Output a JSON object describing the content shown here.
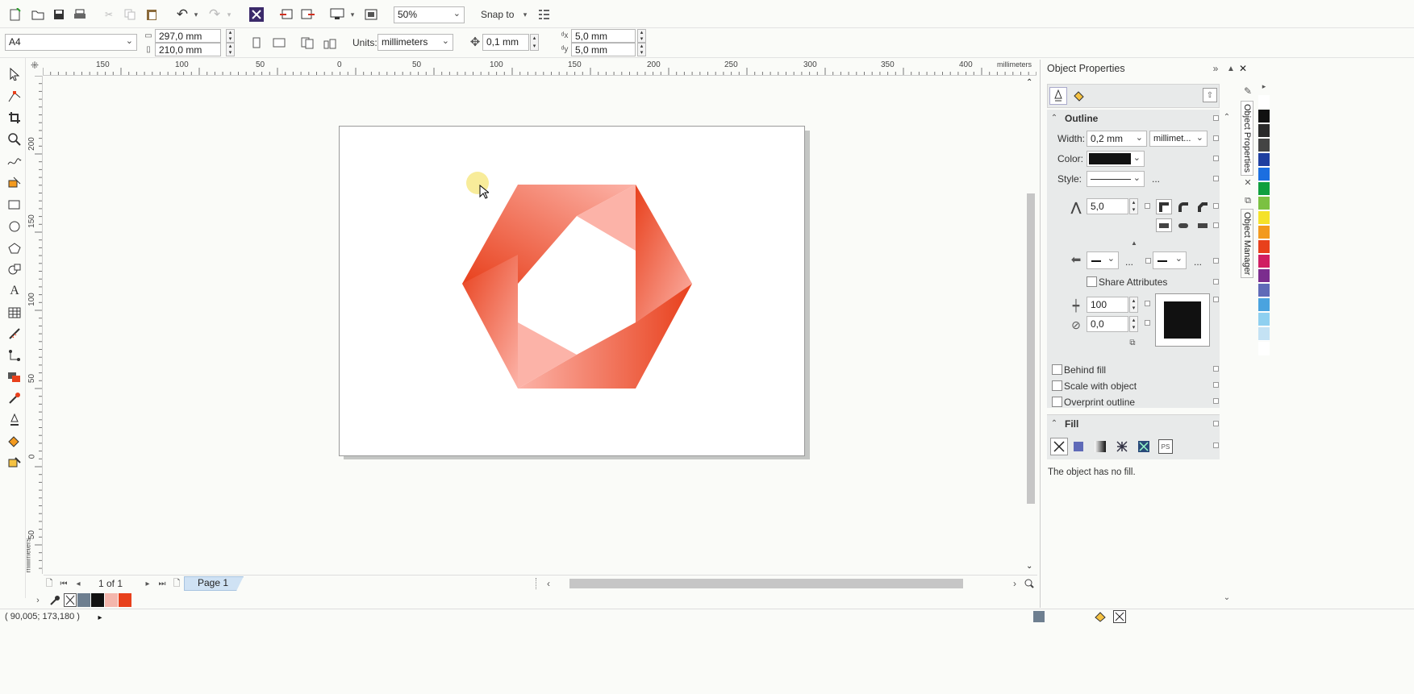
{
  "toolbar": {
    "zoom": "50%",
    "snap_label": "Snap to"
  },
  "propbar": {
    "page_size": "A4",
    "width": "297,0 mm",
    "height": "210,0 mm",
    "units_label": "Units:",
    "units": "millimeters",
    "nudge": "0,1 mm",
    "dup_x": "5,0 mm",
    "dup_y": "5,0 mm"
  },
  "ruler": {
    "h_labels": [
      "150",
      "100",
      "50",
      "0",
      "50",
      "100",
      "150",
      "200",
      "250",
      "300",
      "350",
      "400"
    ],
    "units": "millimeters",
    "v_labels": [
      "200",
      "150",
      "100",
      "50",
      "0",
      "50"
    ],
    "v_units": "millimeters"
  },
  "panel": {
    "title": "Object Properties",
    "outline_title": "Outline",
    "width_label": "Width:",
    "width_value": "0,2 mm",
    "width_units": "millimet...",
    "color_label": "Color:",
    "color_value": "#111111",
    "style_label": "Style:",
    "ellipsis": "...",
    "miter": "5,0",
    "share_attributes": "Share Attributes",
    "stretch": "100",
    "angle": "0,0",
    "behind_fill": "Behind fill",
    "scale_with_object": "Scale with object",
    "overprint_outline": "Overprint outline",
    "fill_title": "Fill",
    "fill_message": "The object has no fill."
  },
  "side_tabs": {
    "tab1": "Object Properties",
    "tab2": "Object Manager"
  },
  "pager": {
    "counter": "1 of 1",
    "page_tab": "Page 1"
  },
  "status": {
    "coords": "( 90,005; 173,180 )"
  },
  "palette": {
    "doc_colors": [
      "#6e7f90",
      "#111111",
      "#f4b6ac",
      "#e8401c"
    ],
    "main_colors": [
      "#ffffff",
      "#111111",
      "#2a2a2a",
      "#444444",
      "#1f3fa0",
      "#1b6ee0",
      "#0f9f3f",
      "#7bc142",
      "#f5e22a",
      "#f39a1e",
      "#e8401c",
      "#d01e62",
      "#7b2d8e",
      "#5f6ab8",
      "#4aa3df",
      "#8fd0f0",
      "#c4e2f4",
      "#ffffff"
    ]
  },
  "colors": {
    "accent": "#e8401c",
    "light": "#fcb3a8",
    "panel_bg": "#e8eaea"
  }
}
